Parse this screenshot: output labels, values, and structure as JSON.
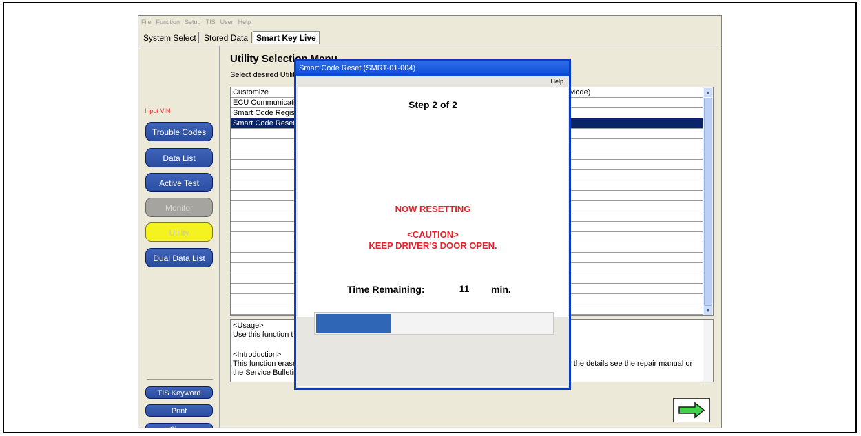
{
  "menu": [
    "File",
    "Function",
    "Setup",
    "TIS",
    "User",
    "Help"
  ],
  "tabs": [
    "System Select",
    "Stored Data",
    "Smart Key Live"
  ],
  "sidebar": {
    "vin_label": "Input VIN",
    "buttons": [
      "Trouble Codes",
      "Data List",
      "Active Test",
      "Monitor",
      "Utility",
      "Dual Data List"
    ],
    "bottom_buttons": [
      "TIS Keyword",
      "Print",
      "Close"
    ]
  },
  "main": {
    "title": "Utility Selection Menu",
    "subtitle": "Select desired Utilit",
    "list_items": [
      "Customize",
      "ECU Communicati",
      "Smart Code Regist",
      "Smart Code Reset"
    ],
    "list_right_text": "g Mode)",
    "desc": {
      "usage_head": "<Usage>",
      "usage_text": "Use this function t",
      "intro_head": "<Introduction>",
      "intro_text": "This function erase",
      "intro_text2": "the Service Bulletin",
      "intro_right": "r the details see the repair manual or"
    }
  },
  "dialog": {
    "title": "Smart Code Reset (SMRT-01-004)",
    "help": "Help",
    "step": "Step 2 of 2",
    "status": "NOW RESETTING",
    "caution_head": "<CAUTION>",
    "caution_text": "KEEP DRIVER'S DOOR OPEN.",
    "time_label": "Time Remaining:",
    "time_value": "11",
    "time_unit": "min.",
    "progress_fraction": 0.32
  },
  "colors": {
    "button_blue": "#2a4d9f",
    "dialog_title": "#0a4ad5",
    "warning_red": "#e8212a",
    "progress_blue": "#2f66b6",
    "utility_yellow": "#f4f21f"
  }
}
